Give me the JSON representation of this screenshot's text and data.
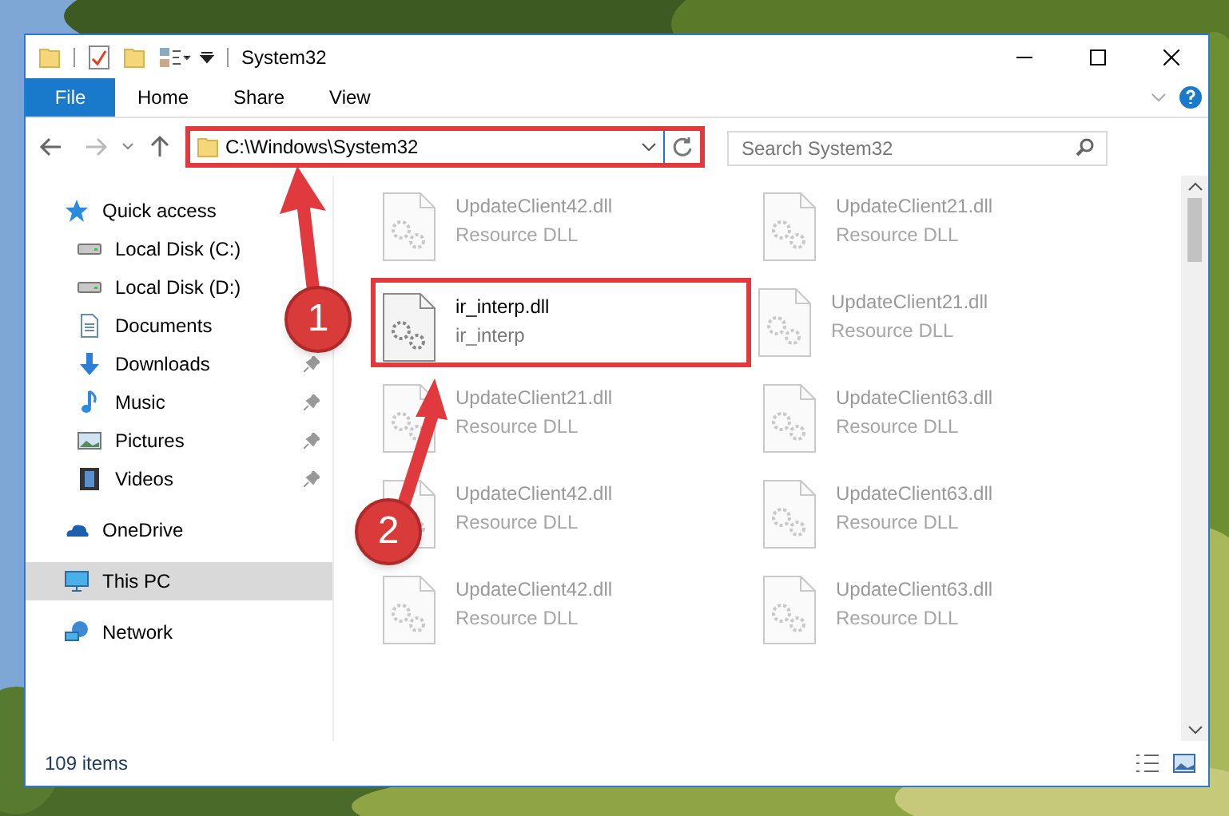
{
  "window": {
    "title": "System32"
  },
  "ribbon_tabs": [
    {
      "label": "File",
      "kind": "file"
    },
    {
      "label": "Home",
      "kind": "tab"
    },
    {
      "label": "Share",
      "kind": "tab"
    },
    {
      "label": "View",
      "kind": "tab"
    }
  ],
  "address": {
    "path": "C:\\Windows\\System32",
    "highlighted": true
  },
  "search": {
    "placeholder": "Search System32"
  },
  "sidebar": {
    "items": [
      {
        "label": "Quick access",
        "selected": false,
        "children": [
          {
            "label": "Local Disk (C:)",
            "pinned": false,
            "selected": false
          },
          {
            "label": "Local Disk (D:)",
            "pinned": false,
            "selected": false
          },
          {
            "label": "Documents",
            "pinned": false,
            "selected": false
          },
          {
            "label": "Downloads",
            "pinned": true,
            "selected": false
          },
          {
            "label": "Music",
            "pinned": true,
            "selected": false
          },
          {
            "label": "Pictures",
            "pinned": true,
            "selected": false
          },
          {
            "label": "Videos",
            "pinned": true,
            "selected": false
          }
        ]
      },
      {
        "label": "OneDrive",
        "selected": false
      },
      {
        "label": "This PC",
        "selected": true
      },
      {
        "label": "Network",
        "selected": false
      }
    ]
  },
  "files": [
    {
      "name": "UpdateClient42.dll",
      "type": "Resource DLL",
      "faded": true,
      "highlighted": false
    },
    {
      "name": "UpdateClient21.dll",
      "type": "Resource DLL",
      "faded": true,
      "highlighted": false
    },
    {
      "name": "ir_interp.dll",
      "type": "ir_interp",
      "faded": false,
      "highlighted": true
    },
    {
      "name": "UpdateClient21.dll",
      "type": "Resource DLL",
      "faded": true,
      "highlighted": false
    },
    {
      "name": "UpdateClient21.dll",
      "type": "Resource DLL",
      "faded": true,
      "highlighted": false
    },
    {
      "name": "UpdateClient63.dll",
      "type": "Resource DLL",
      "faded": true,
      "highlighted": false
    },
    {
      "name": "UpdateClient42.dll",
      "type": "Resource DLL",
      "faded": true,
      "highlighted": false
    },
    {
      "name": "UpdateClient63.dll",
      "type": "Resource DLL",
      "faded": true,
      "highlighted": false
    },
    {
      "name": "UpdateClient42.dll",
      "type": "Resource DLL",
      "faded": true,
      "highlighted": false
    },
    {
      "name": "UpdateClient63.dll",
      "type": "Resource DLL",
      "faded": true,
      "highlighted": false
    }
  ],
  "status_bar": {
    "item_count": "109 items"
  },
  "annotations": [
    {
      "label": "1"
    },
    {
      "label": "2"
    }
  ]
}
